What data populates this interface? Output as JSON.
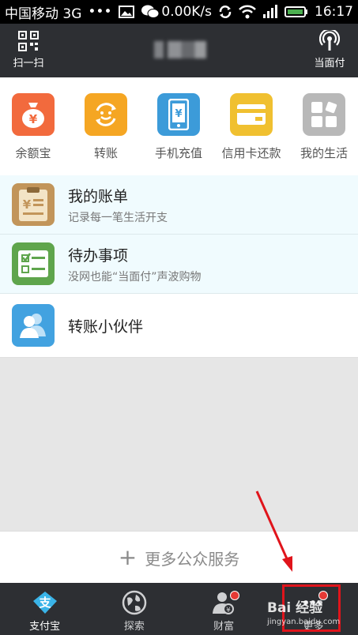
{
  "status_bar": {
    "carrier": "中国移动 3G",
    "dots": "•••",
    "speed": "0.00K/s",
    "time": "16:17"
  },
  "header": {
    "scan_label": "扫一扫",
    "pay_label": "当面付"
  },
  "quick_actions": [
    {
      "label": "余额宝",
      "icon": "money-bag-icon",
      "color": "#f26a3d"
    },
    {
      "label": "转账",
      "icon": "transfer-smile-icon",
      "color": "#f5a623"
    },
    {
      "label": "手机充值",
      "icon": "phone-recharge-icon",
      "color": "#3c9bd9"
    },
    {
      "label": "信用卡还款",
      "icon": "credit-card-icon",
      "color": "#f0c030"
    },
    {
      "label": "我的生活",
      "icon": "grid-icon",
      "color": "#b8b8b8"
    }
  ],
  "rows": [
    {
      "title": "我的账单",
      "subtitle": "记录每一笔生活开支"
    },
    {
      "title": "待办事项",
      "subtitle": "没网也能“当面付”声波购物"
    },
    {
      "title": "转账小伙伴",
      "subtitle": ""
    }
  ],
  "more_services": {
    "label": "更多公众服务",
    "plus": "+"
  },
  "tabs": [
    {
      "label": "支付宝",
      "icon": "alipay-icon"
    },
    {
      "label": "探索",
      "icon": "globe-icon"
    },
    {
      "label": "财富",
      "icon": "wealth-person-icon"
    },
    {
      "label": "更多",
      "icon": "more-icon"
    }
  ],
  "colors": {
    "header_bg": "#2d2f33",
    "row_highlight_bg": "#f0fbfe",
    "highlight_red": "#e0141b"
  },
  "watermark": {
    "brand": "Bai 经验",
    "url": "jingyan.baidu.com"
  }
}
